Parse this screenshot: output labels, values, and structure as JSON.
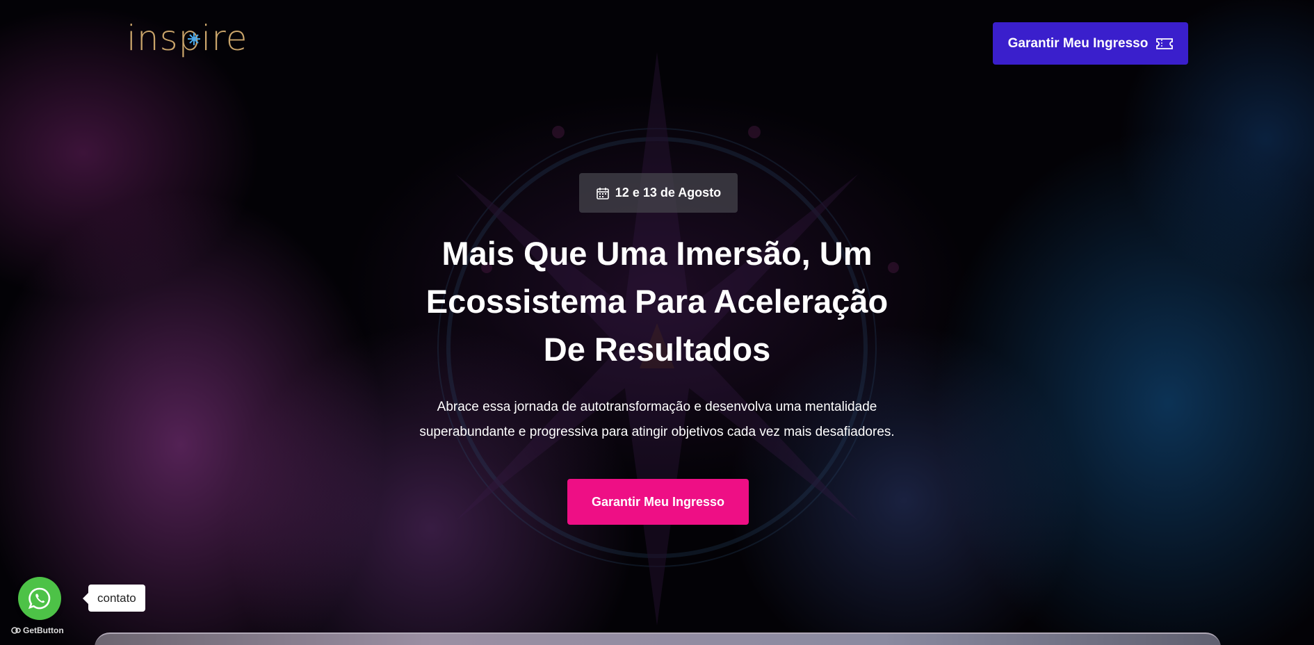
{
  "brand": {
    "logo_text": "inspire",
    "logo_color": "#c9a46a",
    "logo_star_color": "#4aa8e8"
  },
  "header": {
    "cta_label": "Garantir Meu Ingresso",
    "cta_icon": "ticket-icon",
    "cta_color": "#3a1fcc"
  },
  "hero": {
    "date_icon": "calendar-icon",
    "date_label": "12 e 13 de Agosto",
    "headline_lines": [
      "Mais Que Uma Imersão, Um",
      "Ecossistema Para Aceleração",
      "De Resultados"
    ],
    "subtext_lines": [
      "Abrace essa jornada de autotransformação e desenvolva uma mentalidade",
      "superabundante e progressiva para atingir objetivos cada vez mais desafiadores."
    ],
    "cta_label": "Garantir Meu Ingresso",
    "cta_color": "#ee0f85"
  },
  "chat_widget": {
    "icon": "whatsapp-icon",
    "button_color": "#4dc247",
    "tooltip": "contato",
    "powered_by": "GetButton"
  }
}
